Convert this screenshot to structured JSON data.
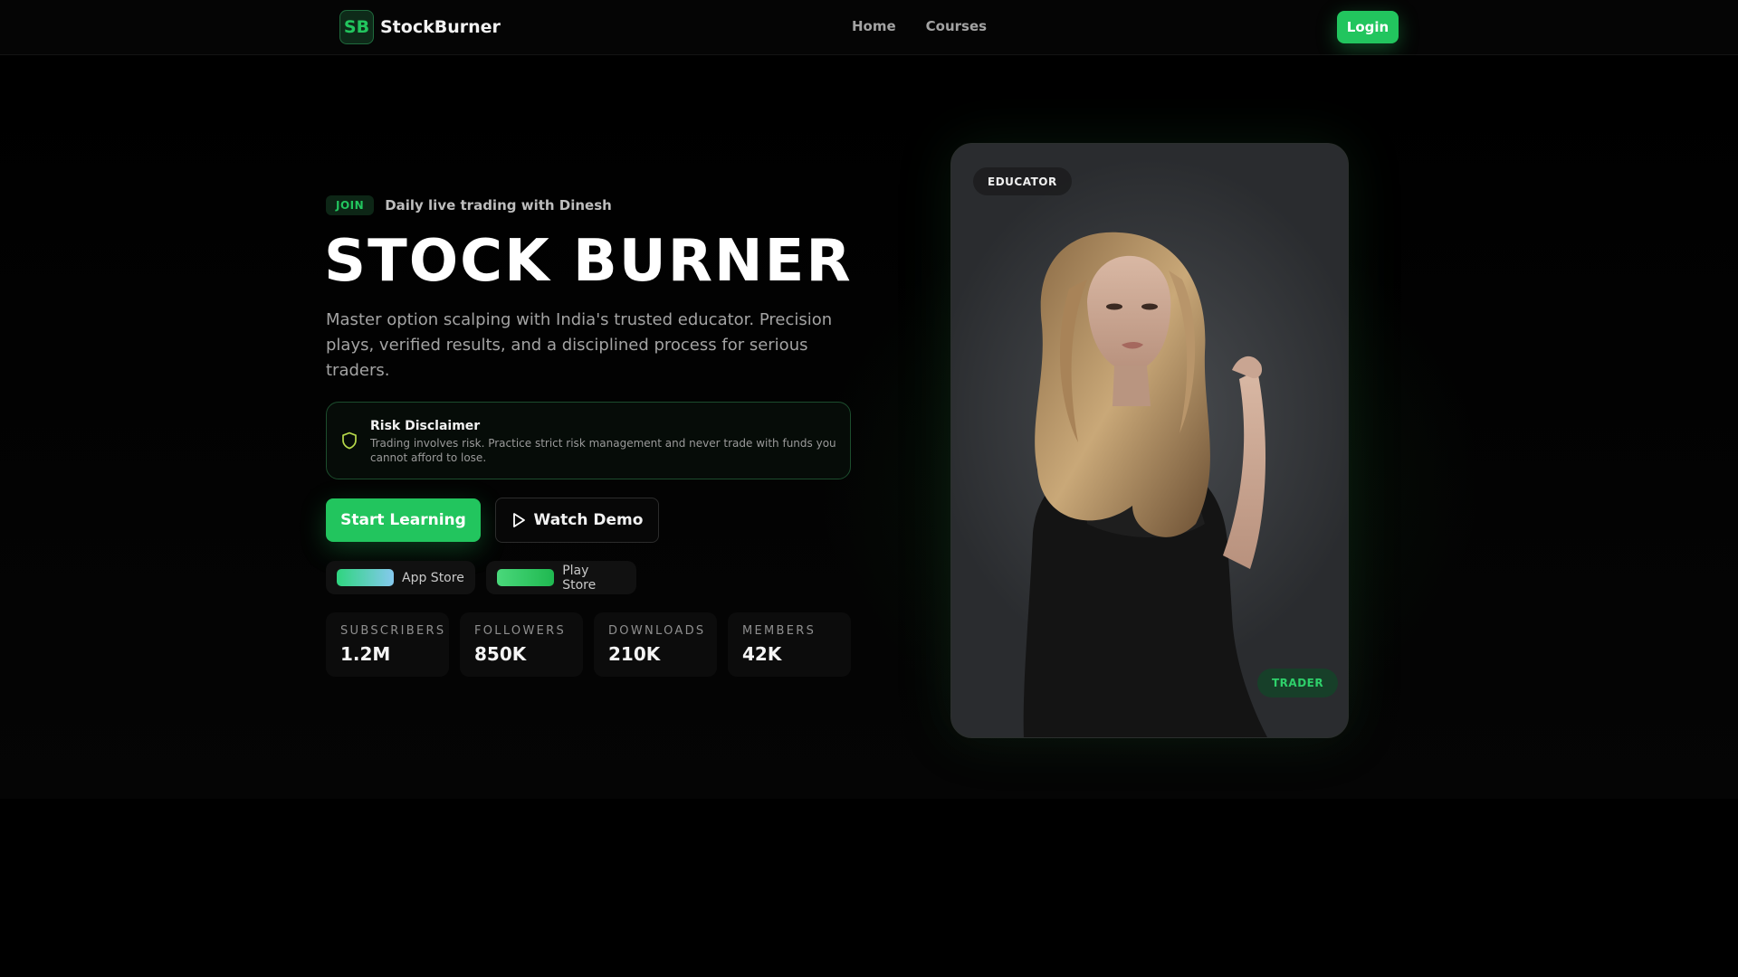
{
  "nav": {
    "logo_mark": "SB",
    "brand": "StockBurner",
    "links": [
      {
        "label": "Home"
      },
      {
        "label": "Courses"
      }
    ],
    "login_label": "Login"
  },
  "hero": {
    "join_badge": "JOIN",
    "join_text": "Daily live trading with Dinesh",
    "title": "STOCK BURNER",
    "description": "Master option scalping with India's trusted educator. Precision plays, verified results, and a disciplined process for serious traders.",
    "disclaimer": {
      "title": "Risk Disclaimer",
      "body": "Trading involves risk. Practice strict risk management and never trade with funds you cannot afford to lose."
    },
    "primary_cta": "Start Learning",
    "secondary_cta": "Watch Demo",
    "stores": [
      {
        "label": "App Store"
      },
      {
        "label": "Play Store"
      }
    ],
    "stats": [
      {
        "label": "SUBSCRIBERS",
        "value": "1.2M"
      },
      {
        "label": "FOLLOWERS",
        "value": "850K"
      },
      {
        "label": "DOWNLOADS",
        "value": "210K"
      },
      {
        "label": "MEMBERS",
        "value": "42K"
      }
    ]
  },
  "card": {
    "top_badge": "EDUCATOR",
    "bottom_badge": "TRADER"
  },
  "icons": {
    "shield": "shield-icon",
    "play": "play-icon"
  },
  "colors": {
    "accent": "#22c55e",
    "background": "#000000"
  }
}
